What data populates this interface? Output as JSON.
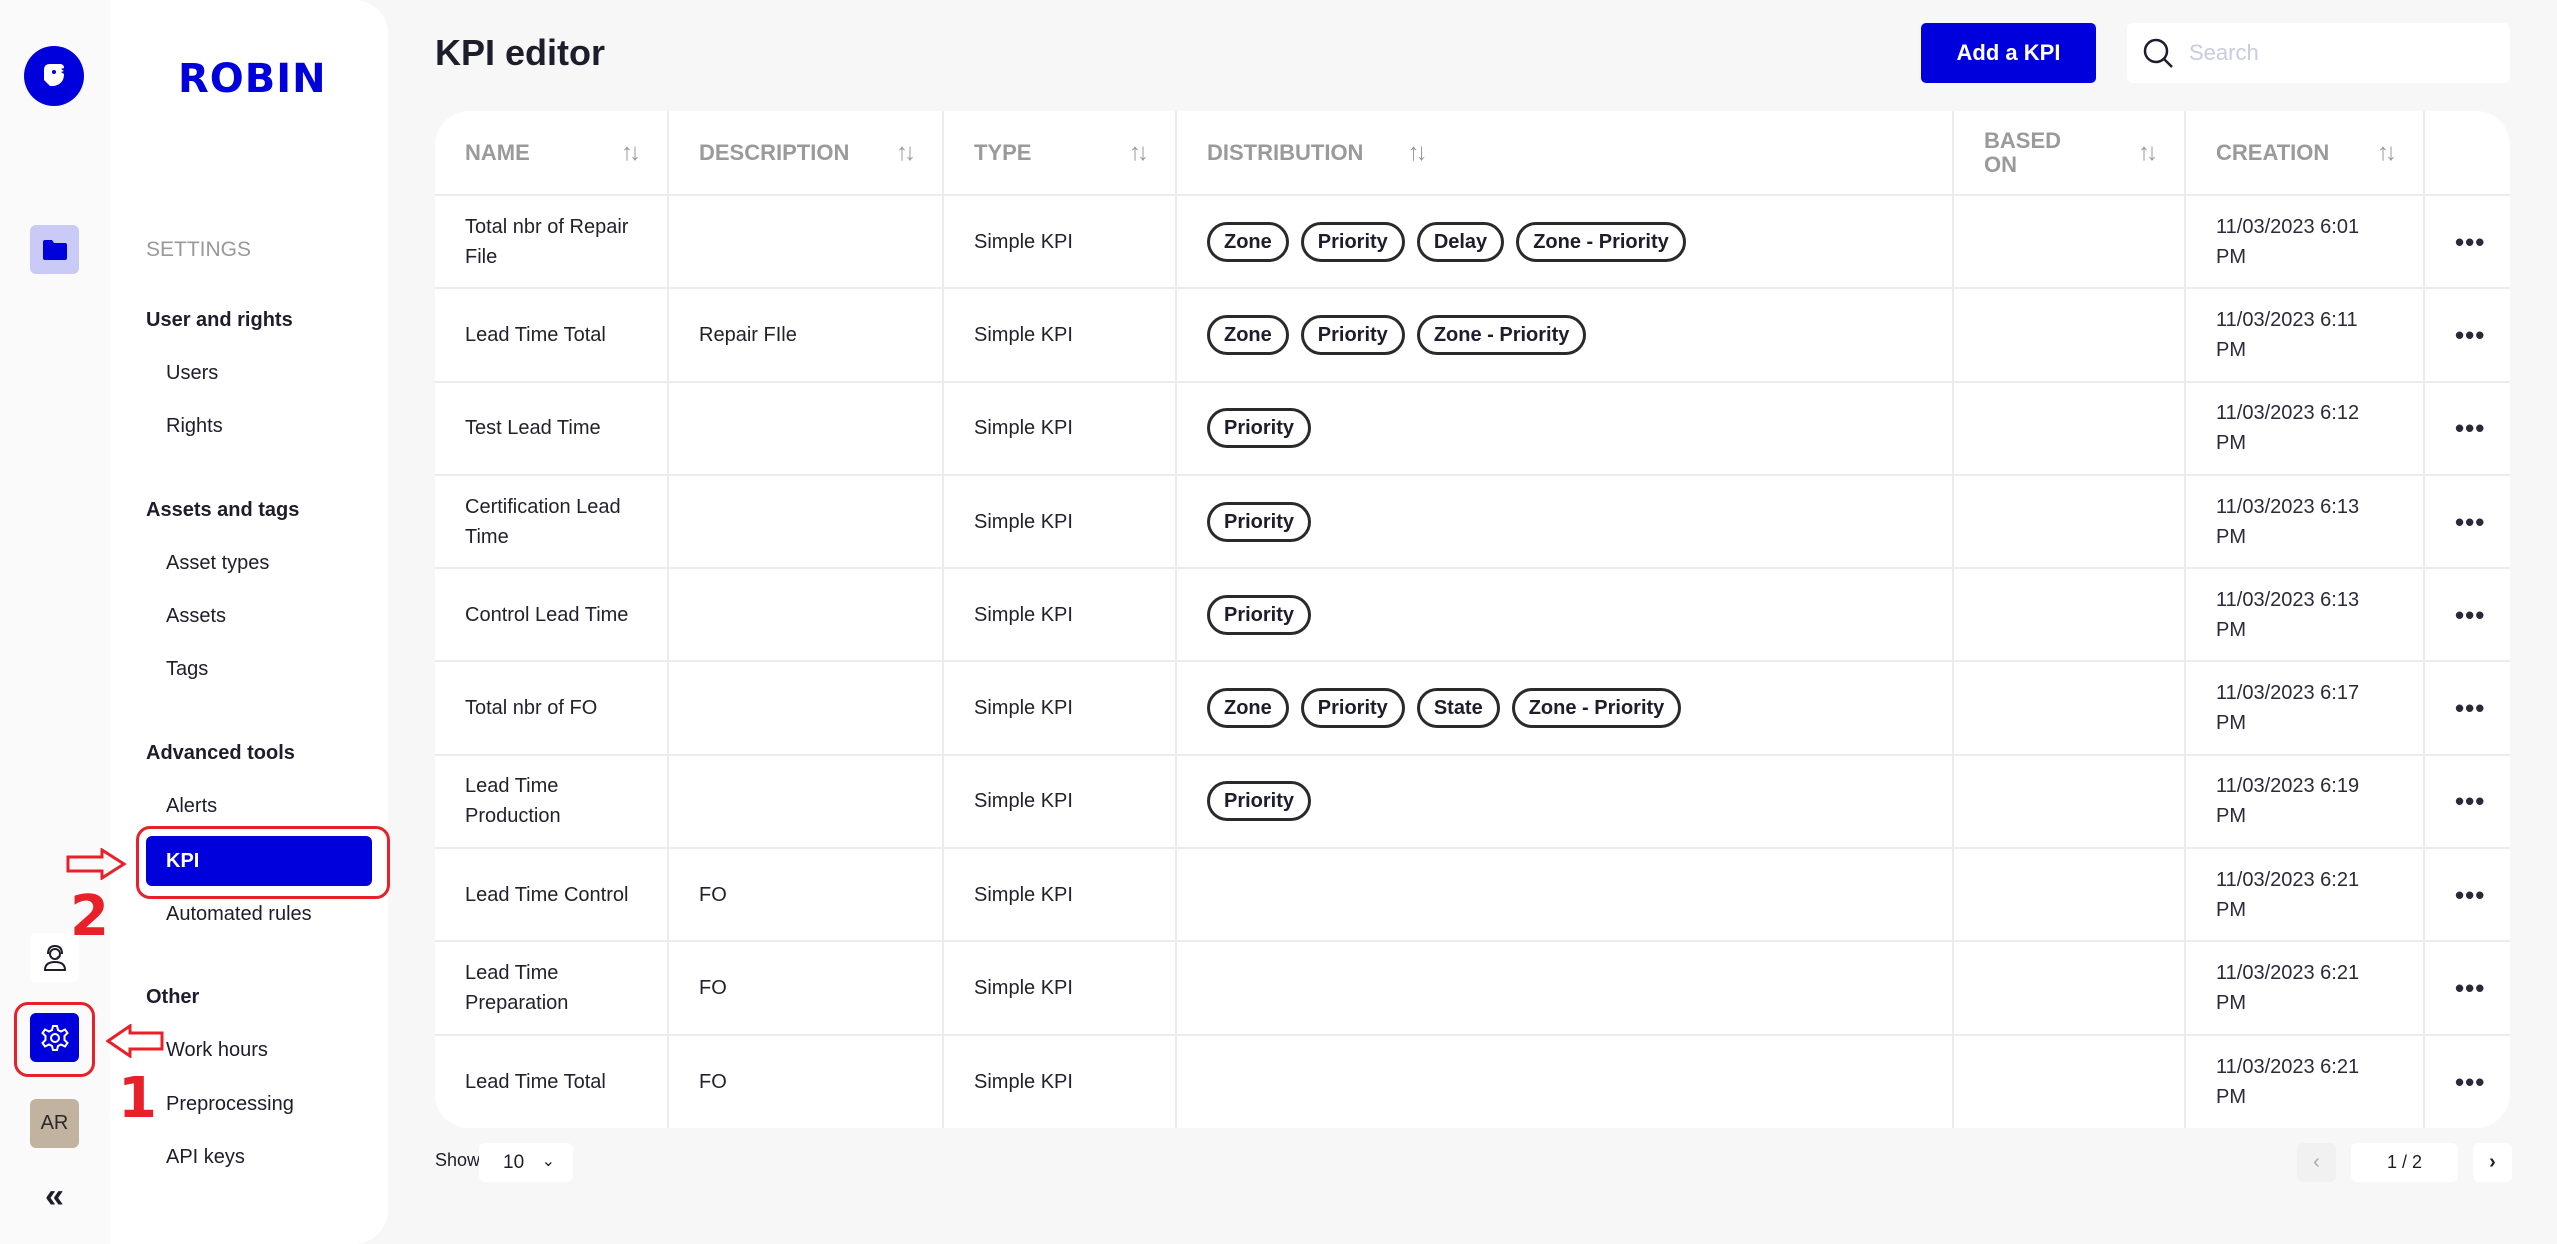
{
  "app": {
    "brand": "ROBIN"
  },
  "rail": {
    "icons": [
      "logo-icon",
      "folder-icon",
      "support-agent-icon",
      "gear-icon",
      "avatar",
      "collapse-icon"
    ],
    "avatar_initials": "AR",
    "collapse_glyph": "«"
  },
  "settings": {
    "heading": "SETTINGS",
    "groups": [
      {
        "title": "User and rights",
        "items": [
          "Users",
          "Rights"
        ]
      },
      {
        "title": "Assets and tags",
        "items": [
          "Asset types",
          "Assets",
          "Tags"
        ]
      },
      {
        "title": "Advanced tools",
        "items": [
          "Alerts",
          "KPI",
          "Automated rules"
        ]
      },
      {
        "title": "Other",
        "items": [
          "Work hours",
          "Preprocessing",
          "API keys"
        ]
      }
    ],
    "active_item": "KPI"
  },
  "annotations": {
    "step1": "1",
    "step2": "2",
    "color": "#e8202a"
  },
  "header": {
    "title": "KPI editor",
    "add_button": "Add a KPI",
    "search_placeholder": "Search",
    "search_value": ""
  },
  "table": {
    "columns": [
      "NAME",
      "DESCRIPTION",
      "TYPE",
      "DISTRIBUTION",
      "BASED ON",
      "CREATION",
      ""
    ],
    "sort_glyph": "↑↓",
    "actions_glyph": "•••",
    "rows": [
      {
        "name": "Total nbr of Repair File",
        "description": "",
        "type": "Simple KPI",
        "distribution": [
          "Zone",
          "Priority",
          "Delay",
          "Zone - Priority"
        ],
        "based_on": "",
        "creation": "11/03/2023 6:01 PM"
      },
      {
        "name": "Lead Time Total",
        "description": "Repair FIle",
        "type": "Simple KPI",
        "distribution": [
          "Zone",
          "Priority",
          "Zone - Priority"
        ],
        "based_on": "",
        "creation": "11/03/2023 6:11 PM"
      },
      {
        "name": "Test Lead Time",
        "description": "",
        "type": "Simple KPI",
        "distribution": [
          "Priority"
        ],
        "based_on": "",
        "creation": "11/03/2023 6:12 PM"
      },
      {
        "name": "Certification Lead Time",
        "description": "",
        "type": "Simple KPI",
        "distribution": [
          "Priority"
        ],
        "based_on": "",
        "creation": "11/03/2023 6:13 PM"
      },
      {
        "name": "Control Lead Time",
        "description": "",
        "type": "Simple KPI",
        "distribution": [
          "Priority"
        ],
        "based_on": "",
        "creation": "11/03/2023 6:13 PM"
      },
      {
        "name": "Total nbr of FO",
        "description": "",
        "type": "Simple KPI",
        "distribution": [
          "Zone",
          "Priority",
          "State",
          "Zone - Priority"
        ],
        "based_on": "",
        "creation": "11/03/2023 6:17 PM"
      },
      {
        "name": "Lead Time Production",
        "description": "",
        "type": "Simple KPI",
        "distribution": [
          "Priority"
        ],
        "based_on": "",
        "creation": "11/03/2023 6:19 PM"
      },
      {
        "name": "Lead Time Control",
        "description": "FO",
        "type": "Simple KPI",
        "distribution": [],
        "based_on": "",
        "creation": "11/03/2023 6:21 PM"
      },
      {
        "name": "Lead Time Preparation",
        "description": "FO",
        "type": "Simple KPI",
        "distribution": [],
        "based_on": "",
        "creation": "11/03/2023 6:21 PM"
      },
      {
        "name": "Lead Time Total",
        "description": "FO",
        "type": "Simple KPI",
        "distribution": [],
        "based_on": "",
        "creation": "11/03/2023 6:21 PM"
      }
    ]
  },
  "footer": {
    "show_label": "Show",
    "page_size": "10",
    "page_info": "1 / 2",
    "prev_glyph": "‹",
    "next_glyph": "›"
  },
  "colors": {
    "accent": "#0000dd",
    "annotation": "#e8202a"
  }
}
